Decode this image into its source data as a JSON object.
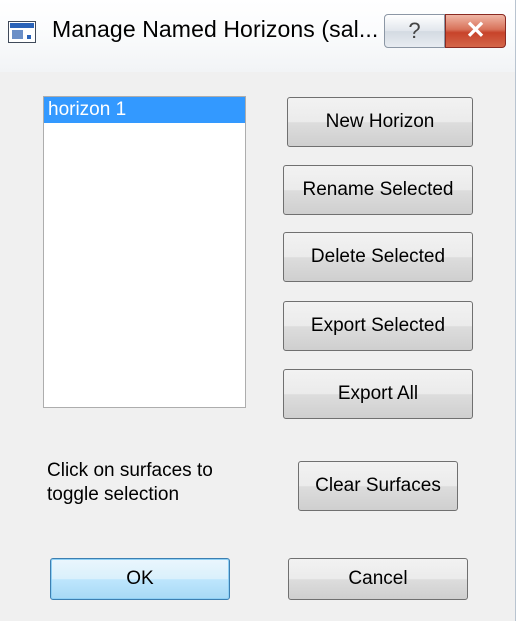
{
  "window": {
    "title": "Manage Named Horizons (sal...",
    "help_glyph": "?",
    "close_glyph": "✕"
  },
  "list": {
    "items": [
      "horizon 1"
    ],
    "selected_index": 0
  },
  "buttons": {
    "new_horizon": "New Horizon",
    "rename_selected": "Rename Selected",
    "delete_selected": "Delete Selected",
    "export_selected": "Export Selected",
    "export_all": "Export All",
    "clear_surfaces": "Clear Surfaces",
    "ok": "OK",
    "cancel": "Cancel"
  },
  "hint": {
    "line1": "Click on surfaces to",
    "line2": "toggle selection"
  },
  "colors": {
    "selection": "#3399ff",
    "close_button": "#c7432a",
    "dialog_background": "#f0f0f0"
  }
}
